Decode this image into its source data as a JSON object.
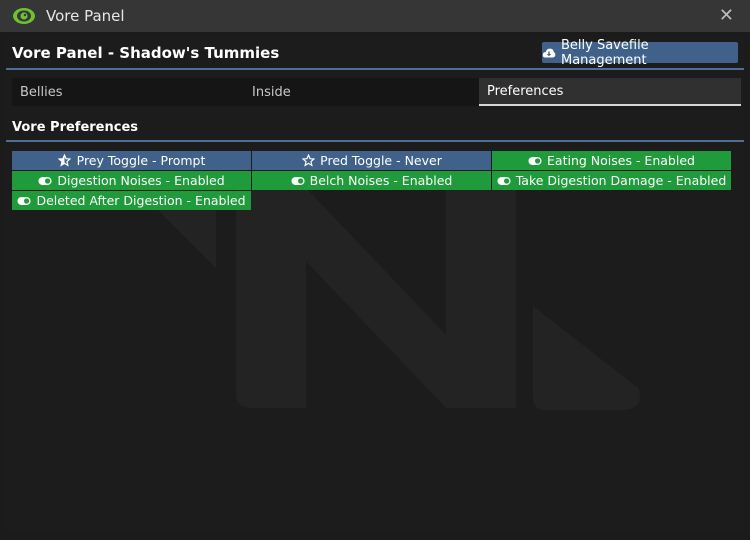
{
  "window": {
    "title": "Vore Panel"
  },
  "header": {
    "title": "Vore Panel - Shadow's Tummies",
    "savefile_button": "Belly Savefile Management"
  },
  "tabs": [
    {
      "label": "Bellies",
      "active": false
    },
    {
      "label": "Inside",
      "active": false
    },
    {
      "label": "Preferences",
      "active": true
    }
  ],
  "preferences": {
    "title": "Vore Preferences",
    "items": [
      {
        "label": "Prey Toggle - Prompt",
        "icon": "star-half-icon",
        "color": "blue"
      },
      {
        "label": "Pred Toggle - Never",
        "icon": "star-outline-icon",
        "color": "blue"
      },
      {
        "label": "Eating Noises - Enabled",
        "icon": "toggle-on-icon",
        "color": "green"
      },
      {
        "label": "Digestion Noises - Enabled",
        "icon": "toggle-on-icon",
        "color": "green"
      },
      {
        "label": "Belch Noises - Enabled",
        "icon": "toggle-on-icon",
        "color": "green"
      },
      {
        "label": "Take Digestion Damage - Enabled",
        "icon": "toggle-on-icon",
        "color": "green"
      },
      {
        "label": "Deleted After Digestion - Enabled",
        "icon": "toggle-on-icon",
        "color": "green"
      }
    ]
  },
  "colors": {
    "accent_blue": "#40628a",
    "enabled_green": "#1f9b3b",
    "eye_green": "#6cc233"
  }
}
